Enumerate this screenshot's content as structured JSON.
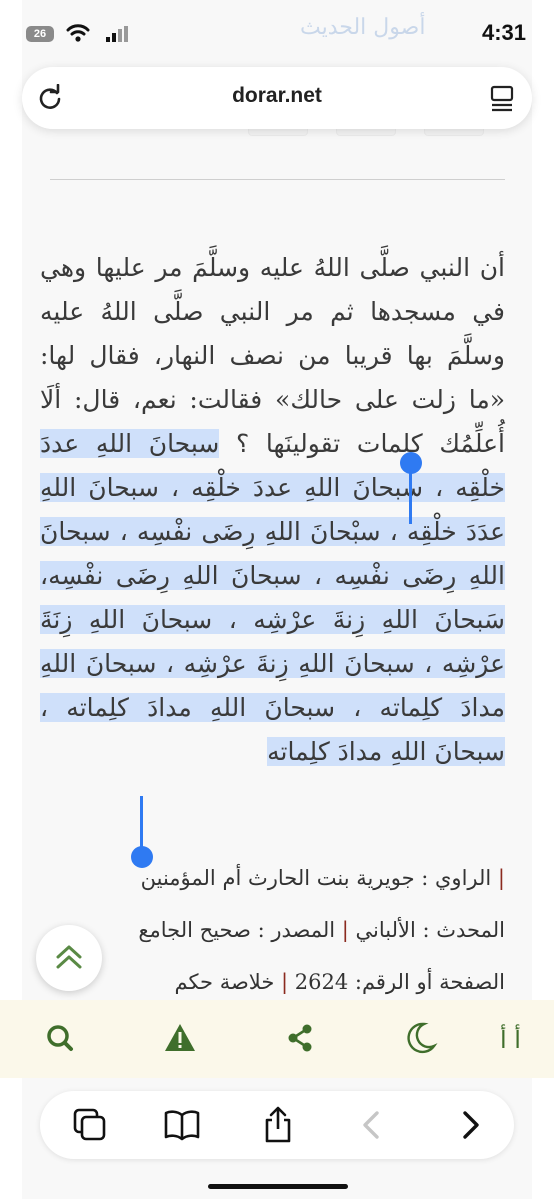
{
  "status_bar": {
    "time": "4:31",
    "battery": "26",
    "faded_title": "أصول الحديث"
  },
  "browser": {
    "domain": "dorar.net"
  },
  "hadith": {
    "text_before": "أن النبي صلَّى اللهُ عليه وسلَّمَ مر عليها وهي في مسجدها ثم مر النبي صلَّى اللهُ عليه وسلَّمَ بها قريبا من نصف النهار، فقال لها: «ما زلت على حالك» فقالت: نعم، قال: ألَا أُعلِّمُك كلمات تقولينَها ؟ ",
    "text_selected": "سبحانَ اللهِ عددَ خلْقِه ، سبحانَ اللهِ عددَ خلْقِه ، سبحانَ اللهِ عدَدَ خلْقِه ، سبْحانَ اللهِ رِضَى نفْسِه ، سبحانَ اللهِ رِضَى نفْسِه ، سبحانَ اللهِ رِضَى نفْسِه، سَبحانَ اللهِ زِنةَ عرْشِه ، سبحانَ اللهِ زِنَةَ عرْشِه ، سبحانَ اللهِ زِنةَ عرْشِه ، سبحانَ اللهِ مدادَ كلِماته ، سبحانَ اللهِ مدادَ كلِماته ، سبحانَ اللهِ مدادَ كلِماته"
  },
  "meta": {
    "narrator": "الراوي : جويرية بنت الحارث أم المؤمنين",
    "muhaddith": "المحدث : الألباني",
    "source": "المصدر : صحيح الجامع",
    "page_label": "الصفحة أو الرقم: 2624",
    "ruling_label": "خلاصة حكم"
  },
  "toolbar": {
    "font_size_label": "أ أ",
    "icons": [
      "search-icon",
      "warning-icon",
      "share-icon",
      "moon-icon",
      "font-size-icon"
    ],
    "accent": "#3f6e2b"
  },
  "safari_bar": {
    "icons": [
      "tabs-icon",
      "bookmarks-icon",
      "share-icon",
      "back-icon",
      "forward-icon"
    ]
  },
  "colors": {
    "selection": "#cfe0fa",
    "selection_handle": "#2f7af2",
    "separator": "#8b2a1f",
    "toolbar_bg": "#fbf8ea"
  }
}
